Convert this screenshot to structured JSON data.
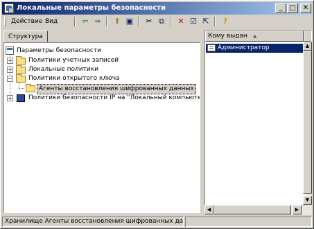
{
  "window": {
    "title": "Локальные параметры безопасности"
  },
  "titlebar": {
    "minimize_glyph": "_",
    "maximize_glyph": "□",
    "close_glyph": "✕"
  },
  "menu": {
    "items": [
      "Действие",
      "Вид"
    ]
  },
  "toolbar": {
    "icons": [
      "back-arrow-icon",
      "forward-arrow-icon",
      "up-folder-icon",
      "show-tree-icon",
      "cut-icon",
      "copy-icon",
      "delete-icon",
      "properties-icon",
      "export-list-icon",
      "help-icon"
    ],
    "glyphs": [
      "⇦",
      "➡",
      "⬆",
      "▣",
      "✂",
      "⧉",
      "✕",
      "☑",
      "⇱",
      "?"
    ],
    "colors": {
      "back": "#0a8a2a",
      "forward": "#808080",
      "delete": "#d00000",
      "help": "#c8a000"
    }
  },
  "tree_tab": {
    "label": "Структура"
  },
  "tree": {
    "root": "Параметры безопасности",
    "items": [
      {
        "label": "Политики учетных записей",
        "expander": "+"
      },
      {
        "label": "Локальные политики",
        "expander": "+"
      },
      {
        "label": "Политики открытого ключа",
        "expander": "−"
      },
      {
        "label": "Агенты восстановления шифрованных данных",
        "selected": true
      },
      {
        "label": "Политики безопасности IP на \"Локальный компьютер\"",
        "expander": "+"
      }
    ]
  },
  "list": {
    "column_header": "Кому выдан",
    "sort_glyph": "▲",
    "rows": [
      "Администратор"
    ]
  },
  "scrollbar": {
    "up": "▲",
    "down": "▼",
    "left": "◀",
    "right": "▶"
  },
  "statusbar": {
    "text": "Хранилище Агенты восстановления шифрованных данных"
  }
}
